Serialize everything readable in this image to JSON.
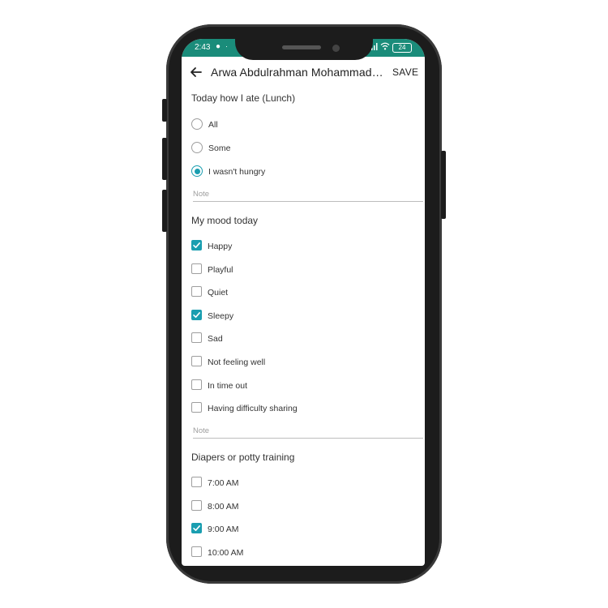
{
  "status": {
    "time": "2:43",
    "battery": "24"
  },
  "appbar": {
    "title": "Arwa Abdulrahman Mohammad Da...",
    "save_label": "SAVE"
  },
  "lunch": {
    "title": "Today how I ate (Lunch)",
    "options": [
      {
        "label": "All",
        "selected": false
      },
      {
        "label": "Some",
        "selected": false
      },
      {
        "label": "I wasn't hungry",
        "selected": true
      }
    ],
    "note_placeholder": "Note"
  },
  "mood": {
    "title": "My mood today",
    "options": [
      {
        "label": "Happy",
        "checked": true
      },
      {
        "label": "Playful",
        "checked": false
      },
      {
        "label": "Quiet",
        "checked": false
      },
      {
        "label": "Sleepy",
        "checked": true
      },
      {
        "label": "Sad",
        "checked": false
      },
      {
        "label": "Not feeling well",
        "checked": false
      },
      {
        "label": "In time out",
        "checked": false
      },
      {
        "label": "Having difficulty sharing",
        "checked": false
      }
    ],
    "note_placeholder": "Note"
  },
  "diapers": {
    "title": "Diapers or potty training",
    "options": [
      {
        "label": "7:00 AM",
        "checked": false
      },
      {
        "label": "8:00 AM",
        "checked": false
      },
      {
        "label": "9:00 AM",
        "checked": true
      },
      {
        "label": "10:00 AM",
        "checked": false
      }
    ]
  },
  "colors": {
    "status_bar": "#1a8c7a",
    "accent": "#1a9eb0"
  }
}
